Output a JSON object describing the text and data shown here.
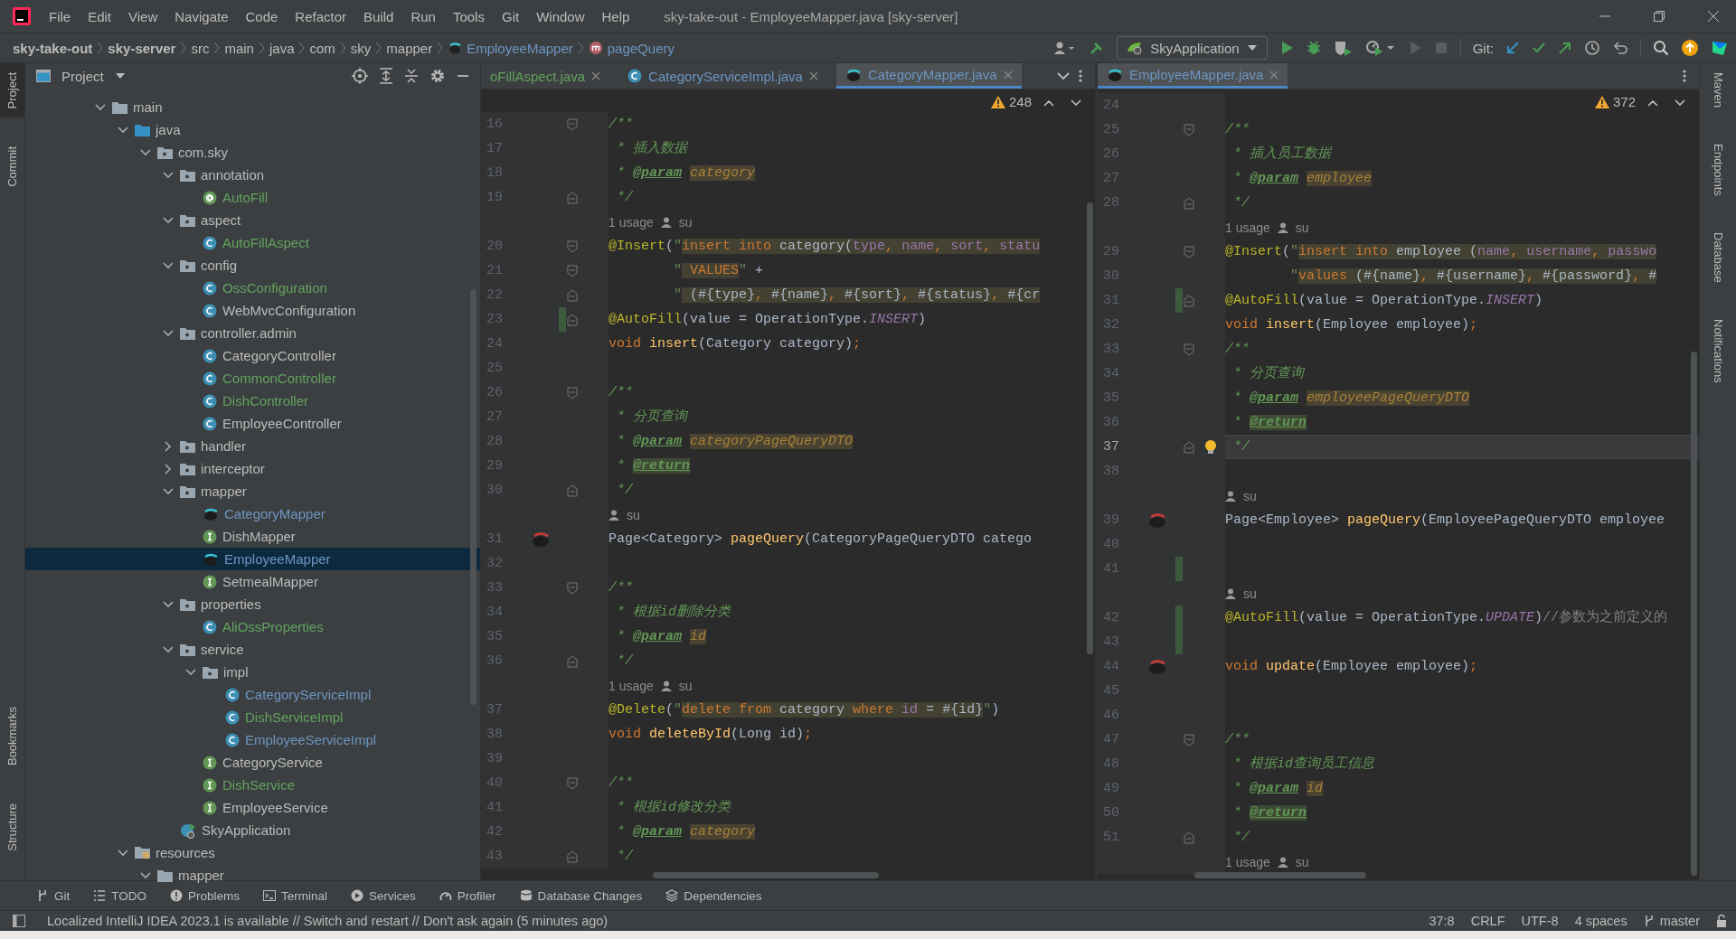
{
  "window": {
    "title": "sky-take-out - EmployeeMapper.java [sky-server]"
  },
  "menu": [
    "File",
    "Edit",
    "View",
    "Navigate",
    "Code",
    "Refactor",
    "Build",
    "Run",
    "Tools",
    "Git",
    "Window",
    "Help"
  ],
  "breadcrumbs": [
    {
      "label": "sky-take-out",
      "kind": "module"
    },
    {
      "label": "sky-server",
      "kind": "module"
    },
    {
      "label": "src",
      "kind": "dir"
    },
    {
      "label": "main",
      "kind": "dir"
    },
    {
      "label": "java",
      "kind": "dir"
    },
    {
      "label": "com",
      "kind": "dir"
    },
    {
      "label": "sky",
      "kind": "dir"
    },
    {
      "label": "mapper",
      "kind": "dir"
    },
    {
      "label": "EmployeeMapper",
      "kind": "mapper"
    },
    {
      "label": "pageQuery",
      "kind": "method"
    }
  ],
  "toolbar": {
    "run_config": "SkyApplication",
    "git_label": "Git:"
  },
  "left_strip": {
    "top": [
      {
        "label": "Project",
        "selected": true
      },
      {
        "label": "Commit",
        "selected": false
      }
    ],
    "bottom": [
      {
        "label": "Bookmarks",
        "selected": false
      },
      {
        "label": "Structure",
        "selected": false
      }
    ]
  },
  "project_panel": {
    "title": "Project",
    "tree": [
      {
        "name": "main",
        "kind": "folder",
        "color": "#bbbbbb",
        "expanded": true,
        "selected": false,
        "children": [
          {
            "name": "java",
            "kind": "srcfolder",
            "color": "#bbbbbb",
            "expanded": true,
            "selected": false,
            "children": [
              {
                "name": "com.sky",
                "kind": "package",
                "color": "#bbbbbb",
                "expanded": true,
                "selected": false,
                "children": [
                  {
                    "name": "annotation",
                    "kind": "package",
                    "color": "#bbbbbb",
                    "expanded": true,
                    "selected": false,
                    "children": [
                      {
                        "name": "AutoFill",
                        "kind": "annotation",
                        "color": "#62a35e",
                        "selected": false
                      }
                    ]
                  },
                  {
                    "name": "aspect",
                    "kind": "package",
                    "color": "#bbbbbb",
                    "expanded": true,
                    "selected": false,
                    "children": [
                      {
                        "name": "AutoFillAspect",
                        "kind": "class",
                        "color": "#62a35e",
                        "selected": false
                      }
                    ]
                  },
                  {
                    "name": "config",
                    "kind": "package",
                    "color": "#bbbbbb",
                    "expanded": true,
                    "selected": false,
                    "children": [
                      {
                        "name": "OssConfiguration",
                        "kind": "class",
                        "color": "#62a35e",
                        "selected": false
                      },
                      {
                        "name": "WebMvcConfiguration",
                        "kind": "class",
                        "color": "#bbbbbb",
                        "selected": false
                      }
                    ]
                  },
                  {
                    "name": "controller.admin",
                    "kind": "package",
                    "color": "#bbbbbb",
                    "expanded": true,
                    "selected": false,
                    "children": [
                      {
                        "name": "CategoryController",
                        "kind": "class",
                        "color": "#bbbbbb",
                        "selected": false
                      },
                      {
                        "name": "CommonController",
                        "kind": "class",
                        "color": "#62a35e",
                        "selected": false
                      },
                      {
                        "name": "DishController",
                        "kind": "class",
                        "color": "#62a35e",
                        "selected": false
                      },
                      {
                        "name": "EmployeeController",
                        "kind": "class",
                        "color": "#bbbbbb",
                        "selected": false
                      }
                    ]
                  },
                  {
                    "name": "handler",
                    "kind": "package",
                    "color": "#bbbbbb",
                    "expanded": false,
                    "selected": false
                  },
                  {
                    "name": "interceptor",
                    "kind": "package",
                    "color": "#bbbbbb",
                    "expanded": false,
                    "selected": false
                  },
                  {
                    "name": "mapper",
                    "kind": "package",
                    "color": "#bbbbbb",
                    "expanded": true,
                    "selected": false,
                    "children": [
                      {
                        "name": "CategoryMapper",
                        "kind": "mybatis",
                        "color": "#6c95c2",
                        "selected": false
                      },
                      {
                        "name": "DishMapper",
                        "kind": "interface",
                        "color": "#bbbbbb",
                        "selected": false
                      },
                      {
                        "name": "EmployeeMapper",
                        "kind": "mybatis",
                        "color": "#6c95c2",
                        "selected": true
                      },
                      {
                        "name": "SetmealMapper",
                        "kind": "interface",
                        "color": "#bbbbbb",
                        "selected": false
                      }
                    ]
                  },
                  {
                    "name": "properties",
                    "kind": "package",
                    "color": "#bbbbbb",
                    "expanded": true,
                    "selected": false,
                    "children": [
                      {
                        "name": "AliOssProperties",
                        "kind": "class",
                        "color": "#62a35e",
                        "selected": false
                      }
                    ]
                  },
                  {
                    "name": "service",
                    "kind": "package",
                    "color": "#bbbbbb",
                    "expanded": true,
                    "selected": false,
                    "children": [
                      {
                        "name": "impl",
                        "kind": "package",
                        "color": "#bbbbbb",
                        "expanded": true,
                        "selected": false,
                        "children": [
                          {
                            "name": "CategoryServiceImpl",
                            "kind": "class",
                            "color": "#6c95c2",
                            "selected": false
                          },
                          {
                            "name": "DishServiceImpl",
                            "kind": "class",
                            "color": "#62a35e",
                            "selected": false
                          },
                          {
                            "name": "EmployeeServiceImpl",
                            "kind": "class",
                            "color": "#6c95c2",
                            "selected": false
                          }
                        ]
                      },
                      {
                        "name": "CategoryService",
                        "kind": "interface",
                        "color": "#bbbbbb",
                        "selected": false
                      },
                      {
                        "name": "DishService",
                        "kind": "interface",
                        "color": "#62a35e",
                        "selected": false
                      },
                      {
                        "name": "EmployeeService",
                        "kind": "interface",
                        "color": "#bbbbbb",
                        "selected": false
                      }
                    ]
                  },
                  {
                    "name": "SkyApplication",
                    "kind": "app",
                    "color": "#bbbbbb",
                    "selected": false
                  }
                ]
              }
            ]
          },
          {
            "name": "resources",
            "kind": "resfolder",
            "color": "#bbbbbb",
            "expanded": true,
            "selected": false,
            "children": [
              {
                "name": "mapper",
                "kind": "folder",
                "color": "#bbbbbb",
                "expanded": true,
                "selected": false
              }
            ]
          }
        ]
      }
    ]
  },
  "editors": [
    {
      "warnings": "248",
      "tabs": [
        {
          "label": "oFillAspect.java",
          "color": "#62a35e",
          "selected": false
        },
        {
          "label": "CategoryServiceImpl.java",
          "kind": "class",
          "color": "#6c95c2",
          "selected": false
        },
        {
          "label": "CategoryMapper.java",
          "kind": "mybatis",
          "color": "#6c95c2",
          "selected": true
        }
      ],
      "lines": [
        {
          "kind": "code",
          "num": "16",
          "changed": false,
          "current": false,
          "tokens": [
            {
              "kind": "c",
              "text": "/**"
            }
          ]
        },
        {
          "kind": "code",
          "num": "17",
          "changed": false,
          "current": false,
          "tokens": [
            {
              "kind": "c",
              "text": " * 插入数据"
            }
          ]
        },
        {
          "kind": "code",
          "num": "18",
          "changed": false,
          "current": false,
          "tokens": [
            {
              "kind": "c",
              "text": " * "
            },
            {
              "kind": "tag",
              "text": "@param"
            },
            {
              "kind": "pn",
              "text": "category"
            }
          ]
        },
        {
          "kind": "code",
          "num": "19",
          "changed": false,
          "current": false,
          "tokens": [
            {
              "kind": "c",
              "text": " */"
            }
          ]
        },
        {
          "kind": "hint",
          "usage": "1 usage",
          "author": "su"
        },
        {
          "kind": "code",
          "num": "20",
          "changed": false,
          "current": false,
          "tokens": [
            {
              "kind": "ann",
              "text": "@Insert"
            },
            {
              "kind": "p",
              "text": "("
            },
            {
              "kind": "str",
              "text": "\""
            },
            {
              "kind": "sk",
              "text": "insert into"
            },
            {
              "kind": "sq",
              "text": " category("
            },
            {
              "kind": "sc",
              "text": "type"
            },
            {
              "kind": "sk",
              "text": ","
            },
            {
              "kind": "sc",
              "text": " name"
            },
            {
              "kind": "sk",
              "text": ","
            },
            {
              "kind": "sc",
              "text": " sort"
            },
            {
              "kind": "sk",
              "text": ","
            },
            {
              "kind": "sc",
              "text": " statu"
            }
          ]
        },
        {
          "kind": "code",
          "num": "21",
          "changed": false,
          "current": false,
          "tokens": [
            {
              "kind": "str",
              "text": "        \""
            },
            {
              "kind": "sk",
              "text": " VALUES"
            },
            {
              "kind": "str",
              "text": "\""
            },
            {
              "kind": "p",
              "text": " +"
            }
          ]
        },
        {
          "kind": "code",
          "num": "22",
          "changed": false,
          "current": false,
          "tokens": [
            {
              "kind": "str",
              "text": "        \""
            },
            {
              "kind": "sq",
              "text": " (#{type}"
            },
            {
              "kind": "sk",
              "text": ","
            },
            {
              "kind": "sq",
              "text": " #{name}"
            },
            {
              "kind": "sk",
              "text": ","
            },
            {
              "kind": "sq",
              "text": " #{sort}"
            },
            {
              "kind": "sk",
              "text": ","
            },
            {
              "kind": "sq",
              "text": " #{status}"
            },
            {
              "kind": "sk",
              "text": ","
            },
            {
              "kind": "sq",
              "text": " #{cr"
            }
          ]
        },
        {
          "kind": "code",
          "num": "23",
          "changed": true,
          "current": false,
          "tokens": [
            {
              "kind": "ann",
              "text": "@AutoFill"
            },
            {
              "kind": "p",
              "text": "(value = OperationType."
            },
            {
              "kind": "const",
              "text": "INSERT"
            },
            {
              "kind": "p",
              "text": ")"
            }
          ]
        },
        {
          "kind": "code",
          "num": "24",
          "changed": false,
          "current": false,
          "tokens": [
            {
              "kind": "kw",
              "text": "void"
            },
            {
              "kind": "fn",
              "text": " insert"
            },
            {
              "kind": "p",
              "text": "(Category category)"
            },
            {
              "kind": "kw",
              "text": ";"
            }
          ]
        },
        {
          "kind": "code",
          "num": "25",
          "changed": false,
          "current": false
        },
        {
          "kind": "code",
          "num": "26",
          "changed": false,
          "current": false,
          "tokens": [
            {
              "kind": "c",
              "text": "/**"
            }
          ]
        },
        {
          "kind": "code",
          "num": "27",
          "changed": false,
          "current": false,
          "tokens": [
            {
              "kind": "c",
              "text": " * 分页查询"
            }
          ]
        },
        {
          "kind": "code",
          "num": "28",
          "changed": false,
          "current": false,
          "tokens": [
            {
              "kind": "c",
              "text": " * "
            },
            {
              "kind": "tag",
              "text": "@param"
            },
            {
              "kind": "pn",
              "text": "categoryPageQueryDTO"
            }
          ]
        },
        {
          "kind": "code",
          "num": "29",
          "changed": false,
          "current": false,
          "tokens": [
            {
              "kind": "c",
              "text": " * "
            },
            {
              "kind": "tagbg",
              "text": "@return"
            }
          ]
        },
        {
          "kind": "code",
          "num": "30",
          "changed": false,
          "current": false,
          "tokens": [
            {
              "kind": "c",
              "text": " */"
            }
          ]
        },
        {
          "kind": "hint",
          "author": "su"
        },
        {
          "kind": "code",
          "num": "31",
          "changed": false,
          "current": false,
          "tokens": [
            {
              "kind": "p",
              "text": "Page<Category> "
            },
            {
              "kind": "fn",
              "text": "pageQuery"
            },
            {
              "kind": "p",
              "text": "(CategoryPageQueryDTO catego"
            }
          ]
        },
        {
          "kind": "code",
          "num": "32",
          "changed": false,
          "current": false
        },
        {
          "kind": "code",
          "num": "33",
          "changed": false,
          "current": false,
          "tokens": [
            {
              "kind": "c",
              "text": "/**"
            }
          ]
        },
        {
          "kind": "code",
          "num": "34",
          "changed": false,
          "current": false,
          "tokens": [
            {
              "kind": "c",
              "text": " * 根据id删除分类"
            }
          ]
        },
        {
          "kind": "code",
          "num": "35",
          "changed": false,
          "current": false,
          "tokens": [
            {
              "kind": "c",
              "text": " * "
            },
            {
              "kind": "tag",
              "text": "@param"
            },
            {
              "kind": "pn",
              "text": "id"
            }
          ]
        },
        {
          "kind": "code",
          "num": "36",
          "changed": false,
          "current": false,
          "tokens": [
            {
              "kind": "c",
              "text": " */"
            }
          ]
        },
        {
          "kind": "hint",
          "usage": "1 usage",
          "author": "su"
        },
        {
          "kind": "code",
          "num": "37",
          "changed": false,
          "current": false,
          "tokens": [
            {
              "kind": "ann",
              "text": "@Delete"
            },
            {
              "kind": "p",
              "text": "("
            },
            {
              "kind": "str",
              "text": "\""
            },
            {
              "kind": "sk",
              "text": "delete from"
            },
            {
              "kind": "sq",
              "text": " category "
            },
            {
              "kind": "sk",
              "text": "where"
            },
            {
              "kind": "sc",
              "text": " id"
            },
            {
              "kind": "sq",
              "text": " = #{id}"
            },
            {
              "kind": "str",
              "text": "\""
            },
            {
              "kind": "p",
              "text": ")"
            }
          ]
        },
        {
          "kind": "code",
          "num": "38",
          "changed": false,
          "current": false,
          "tokens": [
            {
              "kind": "kw",
              "text": "void"
            },
            {
              "kind": "fn",
              "text": " deleteById"
            },
            {
              "kind": "p",
              "text": "(Long id)"
            },
            {
              "kind": "kw",
              "text": ";"
            }
          ]
        },
        {
          "kind": "code",
          "num": "39",
          "changed": false,
          "current": false
        },
        {
          "kind": "code",
          "num": "40",
          "changed": false,
          "current": false,
          "tokens": [
            {
              "kind": "c",
              "text": "/**"
            }
          ]
        },
        {
          "kind": "code",
          "num": "41",
          "changed": false,
          "current": false,
          "tokens": [
            {
              "kind": "c",
              "text": " * 根据id修改分类"
            }
          ]
        },
        {
          "kind": "code",
          "num": "42",
          "changed": false,
          "current": false,
          "tokens": [
            {
              "kind": "c",
              "text": " * "
            },
            {
              "kind": "tag",
              "text": "@param"
            },
            {
              "kind": "pn",
              "text": "category"
            }
          ]
        },
        {
          "kind": "code",
          "num": "43",
          "changed": false,
          "current": false,
          "tokens": [
            {
              "kind": "c",
              "text": " */"
            }
          ]
        }
      ]
    },
    {
      "warnings": "372",
      "tabs": [
        {
          "label": "EmployeeMapper.java",
          "kind": "mybatis",
          "color": "#6c95c2",
          "selected": true
        }
      ],
      "lines": [
        {
          "kind": "code",
          "num": "24",
          "changed": false,
          "current": false
        },
        {
          "kind": "code",
          "num": "25",
          "changed": false,
          "current": false,
          "tokens": [
            {
              "kind": "c",
              "text": "/**"
            }
          ]
        },
        {
          "kind": "code",
          "num": "26",
          "changed": false,
          "current": false,
          "tokens": [
            {
              "kind": "c",
              "text": " * 插入员工数据"
            }
          ]
        },
        {
          "kind": "code",
          "num": "27",
          "changed": false,
          "current": false,
          "tokens": [
            {
              "kind": "c",
              "text": " * "
            },
            {
              "kind": "tag",
              "text": "@param"
            },
            {
              "kind": "pn",
              "text": "employee"
            }
          ]
        },
        {
          "kind": "code",
          "num": "28",
          "changed": false,
          "current": false,
          "tokens": [
            {
              "kind": "c",
              "text": " */"
            }
          ]
        },
        {
          "kind": "hint",
          "usage": "1 usage",
          "author": "su"
        },
        {
          "kind": "code",
          "num": "29",
          "changed": false,
          "current": false,
          "tokens": [
            {
              "kind": "ann",
              "text": "@Insert"
            },
            {
              "kind": "p",
              "text": "("
            },
            {
              "kind": "str",
              "text": "\""
            },
            {
              "kind": "sk",
              "text": "insert into"
            },
            {
              "kind": "sq",
              "text": " employee ("
            },
            {
              "kind": "sc",
              "text": "name"
            },
            {
              "kind": "sk",
              "text": ","
            },
            {
              "kind": "sc",
              "text": " username"
            },
            {
              "kind": "sk",
              "text": ","
            },
            {
              "kind": "sc",
              "text": " passwo"
            }
          ]
        },
        {
          "kind": "code",
          "num": "30",
          "changed": false,
          "current": false,
          "tokens": [
            {
              "kind": "str",
              "text": "        \""
            },
            {
              "kind": "sk",
              "text": "values"
            },
            {
              "kind": "sq",
              "text": " (#{name}"
            },
            {
              "kind": "sk",
              "text": ","
            },
            {
              "kind": "sq",
              "text": " #{username}"
            },
            {
              "kind": "sk",
              "text": ","
            },
            {
              "kind": "sq",
              "text": " #{password}"
            },
            {
              "kind": "sk",
              "text": ","
            },
            {
              "kind": "sq",
              "text": " #"
            }
          ]
        },
        {
          "kind": "code",
          "num": "31",
          "changed": true,
          "current": false,
          "tokens": [
            {
              "kind": "ann",
              "text": "@AutoFill"
            },
            {
              "kind": "p",
              "text": "(value = OperationType."
            },
            {
              "kind": "const",
              "text": "INSERT"
            },
            {
              "kind": "p",
              "text": ")"
            }
          ]
        },
        {
          "kind": "code",
          "num": "32",
          "changed": false,
          "current": false,
          "tokens": [
            {
              "kind": "kw",
              "text": "void"
            },
            {
              "kind": "fn",
              "text": " insert"
            },
            {
              "kind": "p",
              "text": "(Employee employee)"
            },
            {
              "kind": "kw",
              "text": ";"
            }
          ]
        },
        {
          "kind": "code",
          "num": "33",
          "changed": false,
          "current": false,
          "tokens": [
            {
              "kind": "c",
              "text": "/**"
            }
          ]
        },
        {
          "kind": "code",
          "num": "34",
          "changed": false,
          "current": false,
          "tokens": [
            {
              "kind": "c",
              "text": " * 分页查询"
            }
          ]
        },
        {
          "kind": "code",
          "num": "35",
          "changed": false,
          "current": false,
          "tokens": [
            {
              "kind": "c",
              "text": " * "
            },
            {
              "kind": "tag",
              "text": "@param"
            },
            {
              "kind": "pn",
              "text": "employeePageQueryDTO"
            }
          ]
        },
        {
          "kind": "code",
          "num": "36",
          "changed": false,
          "current": false,
          "tokens": [
            {
              "kind": "c",
              "text": " * "
            },
            {
              "kind": "tagbg",
              "text": "@return"
            }
          ]
        },
        {
          "kind": "code",
          "num": "37",
          "changed": false,
          "current": true,
          "tokens": [
            {
              "kind": "c",
              "text": " */"
            }
          ]
        },
        {
          "kind": "code",
          "num": "38",
          "changed": false,
          "current": false
        },
        {
          "kind": "hint",
          "author": "su"
        },
        {
          "kind": "code",
          "num": "39",
          "changed": false,
          "current": false,
          "tokens": [
            {
              "kind": "p",
              "text": "Page<Employee> "
            },
            {
              "kind": "fn",
              "text": "pageQuery"
            },
            {
              "kind": "p",
              "text": "(EmployeePageQueryDTO employee"
            }
          ]
        },
        {
          "kind": "code",
          "num": "40",
          "changed": false,
          "current": false
        },
        {
          "kind": "code",
          "num": "41",
          "changed": true,
          "current": false
        },
        {
          "kind": "hint",
          "author": "su"
        },
        {
          "kind": "code",
          "num": "42",
          "changed": true,
          "current": false,
          "tokens": [
            {
              "kind": "ann",
              "text": "@AutoFill"
            },
            {
              "kind": "p",
              "text": "(value = OperationType."
            },
            {
              "kind": "const",
              "text": "UPDATE"
            },
            {
              "kind": "p",
              "text": ")"
            },
            {
              "kind": "lc",
              "text": "//参数为之前定义的"
            }
          ]
        },
        {
          "kind": "code",
          "num": "43",
          "changed": true,
          "current": false
        },
        {
          "kind": "code",
          "num": "44",
          "changed": false,
          "current": false,
          "tokens": [
            {
              "kind": "kw",
              "text": "void"
            },
            {
              "kind": "fn",
              "text": " update"
            },
            {
              "kind": "p",
              "text": "(Employee employee)"
            },
            {
              "kind": "kw",
              "text": ";"
            }
          ]
        },
        {
          "kind": "code",
          "num": "45",
          "changed": false,
          "current": false
        },
        {
          "kind": "code",
          "num": "46",
          "changed": false,
          "current": false
        },
        {
          "kind": "code",
          "num": "47",
          "changed": false,
          "current": false,
          "tokens": [
            {
              "kind": "c",
              "text": "/**"
            }
          ]
        },
        {
          "kind": "code",
          "num": "48",
          "changed": false,
          "current": false,
          "tokens": [
            {
              "kind": "c",
              "text": " * 根据id查询员工信息"
            }
          ]
        },
        {
          "kind": "code",
          "num": "49",
          "changed": false,
          "current": false,
          "tokens": [
            {
              "kind": "c",
              "text": " * "
            },
            {
              "kind": "tag",
              "text": "@param"
            },
            {
              "kind": "pn",
              "text": "id"
            }
          ]
        },
        {
          "kind": "code",
          "num": "50",
          "changed": false,
          "current": false,
          "tokens": [
            {
              "kind": "c",
              "text": " * "
            },
            {
              "kind": "tagbg",
              "text": "@return"
            }
          ]
        },
        {
          "kind": "code",
          "num": "51",
          "changed": false,
          "current": false,
          "tokens": [
            {
              "kind": "c",
              "text": " */"
            }
          ]
        },
        {
          "kind": "hint",
          "usage": "1 usage",
          "author": "su"
        }
      ]
    }
  ],
  "right_strip": [
    "Maven",
    "Endpoints",
    "Database",
    "Notifications"
  ],
  "tool_windows": [
    {
      "label": "Git",
      "kind": "git"
    },
    {
      "label": "TODO",
      "kind": "todo"
    },
    {
      "label": "Problems",
      "kind": "problems"
    },
    {
      "label": "Terminal",
      "kind": "terminal"
    },
    {
      "label": "Services",
      "kind": "services"
    },
    {
      "label": "Profiler",
      "kind": "profiler"
    },
    {
      "label": "Database Changes",
      "kind": "database"
    },
    {
      "label": "Dependencies",
      "kind": "dependencies"
    }
  ],
  "status_bar": {
    "message": "Localized IntelliJ IDEA 2023.1 is available // Switch and restart // Don't ask again (5 minutes ago)",
    "position": "37:8",
    "line_ending": "CRLF",
    "encoding": "UTF-8",
    "indent": "4 spaces",
    "branch": "master"
  }
}
